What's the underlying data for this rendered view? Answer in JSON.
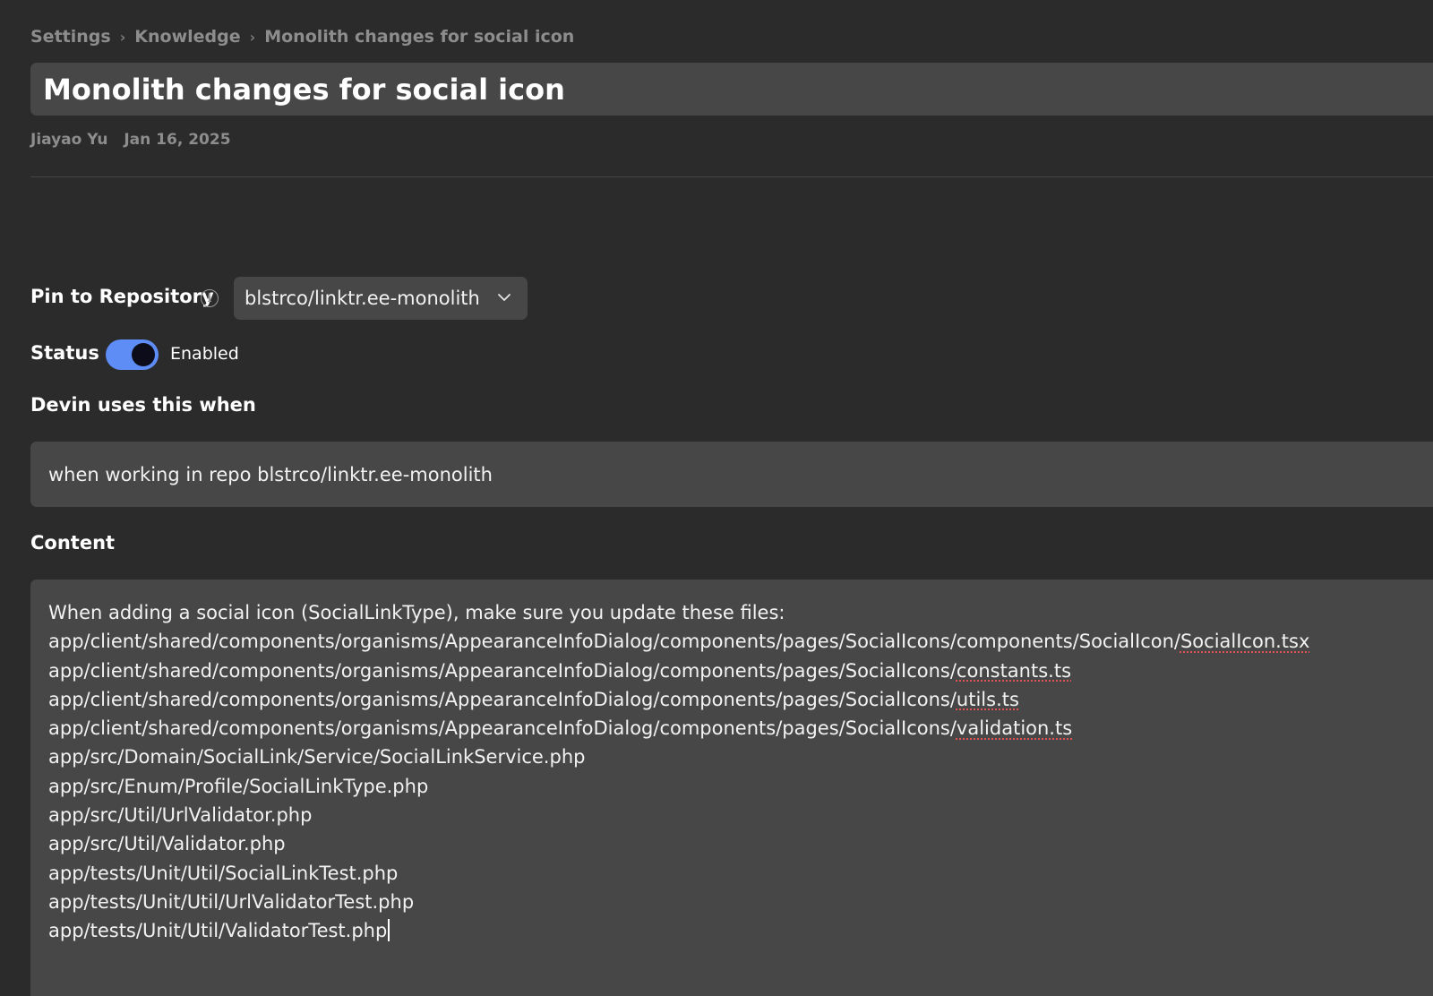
{
  "breadcrumb": {
    "items": [
      "Settings",
      "Knowledge",
      "Monolith changes for social icon"
    ]
  },
  "title": "Monolith changes for social icon",
  "meta": {
    "author": "Jiayao Yu",
    "date": "Jan 16, 2025"
  },
  "pin": {
    "label": "Pin to Repository",
    "info_icon": "info-icon",
    "selected_repo": "blstrco/linktr.ee-monolith",
    "dropdown_icon": "chevron-down-icon"
  },
  "status": {
    "label": "Status",
    "toggle_state": "on",
    "toggle_text": "Enabled"
  },
  "trigger": {
    "label": "Devin uses this when",
    "value": "when working in repo blstrco/linktr.ee-monolith"
  },
  "content": {
    "label": "Content",
    "intro": "When adding a social icon (SocialLinkType), make sure you update these files:",
    "paths": [
      {
        "prefix": "app/client/shared/components/organisms/AppearanceInfoDialog/components/pages/SocialIcons/components/SocialIcon/",
        "file": "SocialIcon.tsx"
      },
      {
        "prefix": "app/client/shared/components/organisms/AppearanceInfoDialog/components/pages/SocialIcons/",
        "file": "constants.ts"
      },
      {
        "prefix": "app/client/shared/components/organisms/AppearanceInfoDialog/components/pages/SocialIcons/",
        "file": "utils.ts"
      },
      {
        "prefix": "app/client/shared/components/organisms/AppearanceInfoDialog/components/pages/SocialIcons/",
        "file": "validation.ts"
      }
    ],
    "plain_paths": [
      "app/src/Domain/SocialLink/Service/SocialLinkService.php",
      "app/src/Enum/Profile/SocialLinkType.php",
      "app/src/Util/UrlValidator.php",
      "app/src/Util/Validator.php",
      "app/tests/Unit/Util/SocialLinkTest.php",
      "app/tests/Unit/Util/UrlValidatorTest.php",
      "app/tests/Unit/Util/ValidatorTest.php"
    ]
  },
  "colors": {
    "background": "#2b2b2b",
    "field": "#474747",
    "toggle_on": "#5e8df5",
    "muted_text": "#8d8d8d"
  }
}
